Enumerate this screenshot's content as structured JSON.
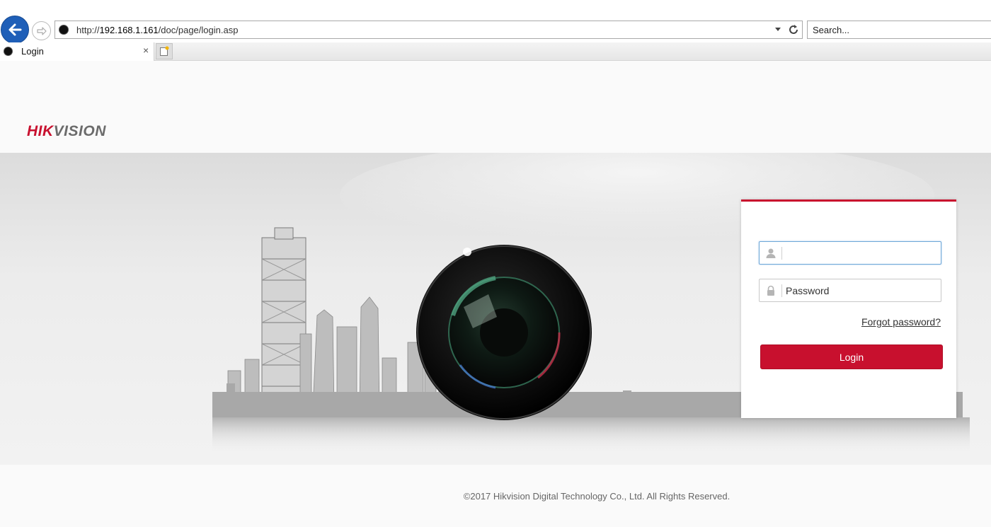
{
  "browser": {
    "url_prefix": "http://",
    "url_host": "192.168.1.161",
    "url_path": "/doc/page/login.asp",
    "search_placeholder": "Search...",
    "tab_title": "Login",
    "tab_close": "×"
  },
  "brand": {
    "logo_part1": "HIK",
    "logo_part2": "VISION",
    "accent_color": "#c8102e"
  },
  "login": {
    "username_value": "",
    "password_placeholder": "Password",
    "forgot_link": "Forgot password?",
    "login_button": "Login"
  },
  "footer": {
    "copyright": "©2017 Hikvision Digital Technology Co., Ltd. All Rights Reserved."
  }
}
